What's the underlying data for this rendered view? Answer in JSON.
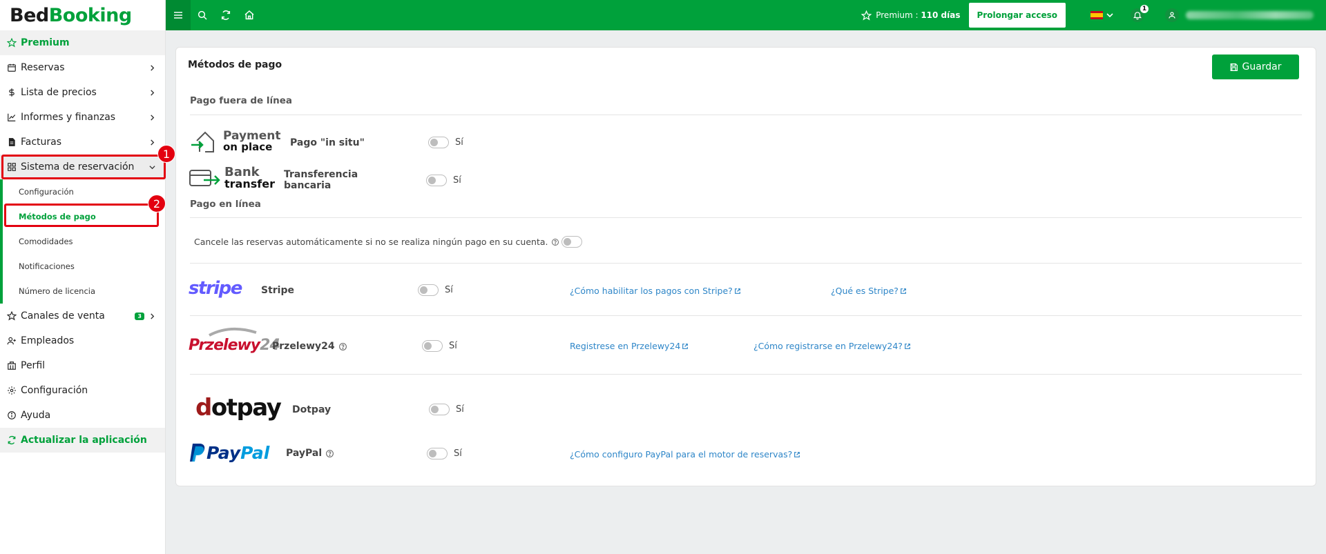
{
  "brand": {
    "part1": "Bed",
    "part2": "Booking"
  },
  "sidebar": {
    "premium": "Premium",
    "items": [
      {
        "label": "Reservas"
      },
      {
        "label": "Lista de precios"
      },
      {
        "label": "Informes y finanzas"
      },
      {
        "label": "Facturas"
      },
      {
        "label": "Sistema de reservación"
      }
    ],
    "submenu": [
      {
        "label": "Configuración"
      },
      {
        "label": "Métodos de pago"
      },
      {
        "label": "Comodidades"
      },
      {
        "label": "Notificaciones"
      },
      {
        "label": "Número de licencia"
      }
    ],
    "more_items": [
      {
        "label": "Canales de venta",
        "badge": "3"
      },
      {
        "label": "Empleados"
      },
      {
        "label": "Perfil"
      },
      {
        "label": "Configuración"
      },
      {
        "label": "Ayuda"
      }
    ],
    "update": "Actualizar la aplicación"
  },
  "annotations": {
    "first": "1",
    "second": "2"
  },
  "topbar": {
    "premium_label": "Premium : ",
    "premium_days": "110 días",
    "prolong": "Prolongar acceso",
    "notifications_count": "1"
  },
  "page": {
    "title": "Métodos de pago",
    "save": "Guardar",
    "offline_section": "Pago fuera de línea",
    "online_section": "Pago en línea",
    "auto_cancel": "Cancele las reservas automáticamente si no se realiza ningún pago en su cuenta.",
    "toggle_yes": "Sí",
    "logos": {
      "payment_on_place_1": "Payment",
      "payment_on_place_2": "on place",
      "bank_transfer_1": "Bank",
      "bank_transfer_2": "transfer",
      "stripe": "stripe",
      "p24_a": "Przelewy",
      "p24_b": "24",
      "dotpay_a": "d",
      "dotpay_b": "o",
      "dotpay_c": "tpay",
      "paypal_a": "Pay",
      "paypal_b": "Pal"
    },
    "methods": {
      "in_situ": "Pago \"in situ\"",
      "bank_1": "Transferencia",
      "bank_2": "bancaria",
      "stripe": "Stripe",
      "stripe_link1": "¿Cómo habilitar los pagos con Stripe?",
      "stripe_link2": "¿Qué es Stripe?",
      "p24": "Przelewy24",
      "p24_link1": "Registrese en Przelewy24",
      "p24_link2": "¿Cómo registrarse en Przelewy24?",
      "dotpay": "Dotpay",
      "paypal": "PayPal",
      "paypal_link": "¿Cómo configuro PayPal para el motor de reservas?"
    }
  },
  "colors": {
    "brand": "#00a13b",
    "annotation": "#e3000f",
    "link": "#2e86c8"
  }
}
